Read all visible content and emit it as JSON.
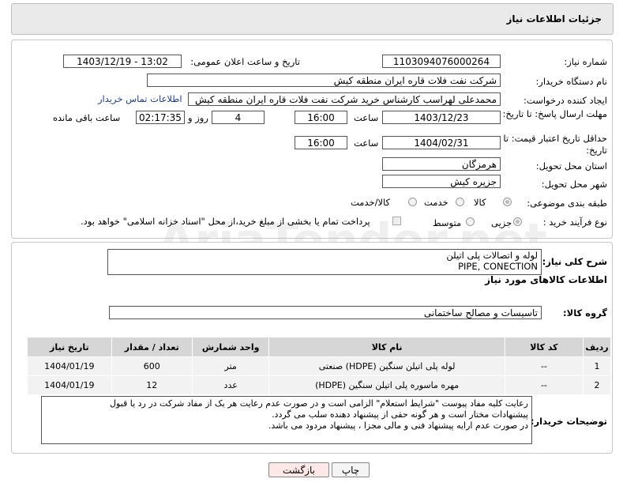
{
  "header": {
    "title": "جزئیات اطلاعات نیاز"
  },
  "form": {
    "need_number_label": "شماره نیاز:",
    "need_number": "1103094076000264",
    "announce_label": "تاریخ و ساعت اعلان عمومی:",
    "announce_value": "1403/12/19 - 13:02",
    "buyer_org_label": "نام دستگاه خریدار:",
    "buyer_org": "شرکت نفت فلات قاره ایران منطقه کیش",
    "creator_label": "ایجاد کننده درخواست:",
    "creator": "محمدعلی لهراسب کارشناس خرید شرکت نفت فلات قاره ایران منطقه کیش",
    "contact_link": "اطلاعات تماس خریدار",
    "reply_deadline_label": "مهلت ارسال پاسخ: تا تاریخ:",
    "reply_date": "1403/12/23",
    "time_label": "ساعت",
    "reply_time": "16:00",
    "days_value": "4",
    "days_label": "روز و",
    "remaining_value": "02:17:35",
    "remaining_label": "ساعت باقی مانده",
    "price_validity_label": "حداقل تاریخ اعتبار قیمت: تا تاریخ:",
    "price_date": "1404/02/31",
    "price_time": "16:00",
    "province_label": "استان محل تحویل:",
    "province": "هرمزگان",
    "city_label": "شهر محل تحویل:",
    "city": "جزیره کیش",
    "category_label": "طبقه بندی موضوعی:",
    "category_options": [
      "کالا",
      "خدمت",
      "کالا/خدمت"
    ],
    "process_label": "نوع فرآیند خرید :",
    "process_options": [
      "جزیی",
      "متوسط"
    ],
    "payment_note": "پرداخت تمام یا بخشی از مبلغ خرید،از محل \"اسناد خزانه اسلامی\" خواهد بود."
  },
  "details": {
    "summary_label": "شرح کلی نیاز:",
    "summary_line1": "لوله و اتصالات پلی اتیلن",
    "summary_line2": "PIPE, CONECTION",
    "goods_info_title": "اطلاعات کالاهای مورد نیاز",
    "group_label": "گروه کالا:",
    "group_value": "تاسیسات و مصالح ساختمانی",
    "table": {
      "headers": [
        "ردیف",
        "کد کالا",
        "نام کالا",
        "واحد شمارش",
        "تعداد / مقدار",
        "تاریخ نیاز"
      ],
      "rows": [
        [
          "1",
          "--",
          "لوله پلی اتیلن سنگین (HDPE) صنعتی",
          "متر",
          "600",
          "1404/01/19"
        ],
        [
          "2",
          "--",
          "مهره ماسوره پلی اتیلن سنگین (HDPE)",
          "عدد",
          "12",
          "1404/01/19"
        ]
      ]
    },
    "buyer_notes_label": "توضیحات خریدار:",
    "buyer_notes_line1": "رعایت کلیه مفاد  پیوست \"شرایط استعلام\" الزامی است و در صورت عدم رعایت هر یک از مفاد شرکت در رد یا قبول",
    "buyer_notes_line2": "پیشنهادات مختار است  و هر گونه حقی از پیشنهاد دهنده سلب می گردد.",
    "buyer_notes_line3": "در صورت عدم ارایه پیشنهاد فنی و مالی مجزا ، پیشنهاد مردود می باشد."
  },
  "buttons": {
    "print": "چاپ",
    "back": "بازگشت"
  },
  "watermark": "AriaTender.net"
}
